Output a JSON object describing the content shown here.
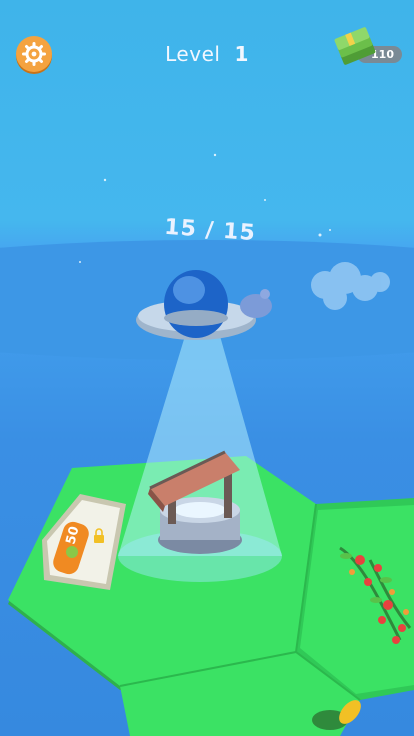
{
  "hud": {
    "level_label": "Level",
    "level_number": "1",
    "money_amount": "110",
    "settings_icon": "gear-icon",
    "money_icon": "cash-stack-icon"
  },
  "ufo": {
    "counter": "15 / 15"
  },
  "unlock_sign": {
    "price": "50",
    "icon": "lock-icon"
  },
  "colors": {
    "sky": "#45b7ee",
    "sea": "#3a8fe4",
    "grass": "#37e35f",
    "settings": "#f4a340"
  }
}
